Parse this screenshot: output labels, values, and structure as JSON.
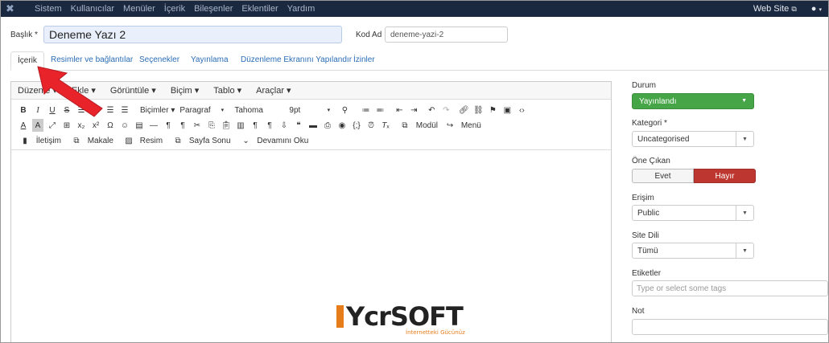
{
  "topnav": {
    "logo_icon": "joomla-icon",
    "items": [
      "Sistem",
      "Kullanıcılar",
      "Menüler",
      "İçerik",
      "Bileşenler",
      "Eklentiler",
      "Yardım"
    ],
    "site_link": "Web Site",
    "site_icon": "external-link-icon",
    "user_icon": "user-icon"
  },
  "form": {
    "title_label": "Başlık *",
    "title_value": "Deneme Yazı 2",
    "alias_label": "Kod Ad",
    "alias_value": "deneme-yazi-2"
  },
  "tabs": [
    "İçerik",
    "Resimler ve bağlantılar",
    "Seçenekler",
    "Yayınlama",
    "Düzenleme Ekranını Yapılandır",
    "İzinler"
  ],
  "editor": {
    "menus": [
      "Düzenle ▾",
      "Ekle ▾",
      "Görüntüle ▾",
      "Biçim ▾",
      "Tablo ▾",
      "Araçlar ▾"
    ],
    "formats_label": "Biçimler ▾",
    "block_label": "Paragraf",
    "font_label": "Tahoma",
    "size_label": "9pt",
    "row3": [
      "İletişim",
      "Makale",
      "Resim",
      "Sayfa Sonu",
      "Devamını Oku"
    ],
    "module_label": "Modül",
    "menu_label": "Menü"
  },
  "watermark": {
    "brand": "YcrSOFT",
    "tagline": "İnternetteki Gücünüz"
  },
  "sidebar": {
    "status_label": "Durum",
    "status_value": "Yayınlandı",
    "category_label": "Kategori *",
    "category_value": "Uncategorised",
    "featured_label": "Öne Çıkan",
    "featured_yes": "Evet",
    "featured_no": "Hayır",
    "access_label": "Erişim",
    "access_value": "Public",
    "language_label": "Site Dili",
    "language_value": "Tümü",
    "tags_label": "Etiketler",
    "tags_placeholder": "Type or select some tags",
    "note_label": "Not",
    "note_value": ""
  },
  "colors": {
    "topnav_bg": "#1b2940",
    "status_green": "#46a546",
    "no_red": "#bd362f",
    "annotation_arrow": "#e8232a",
    "brand_orange": "#e77c1b"
  }
}
